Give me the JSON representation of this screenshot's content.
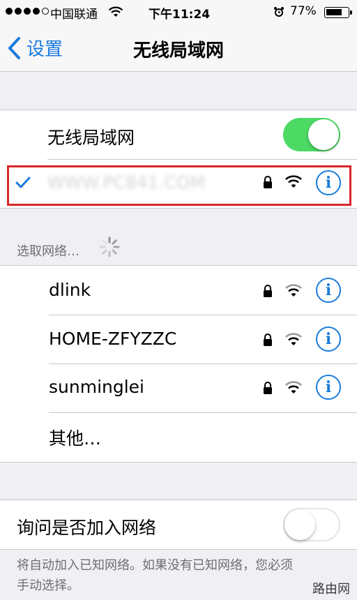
{
  "status_bar": {
    "carrier": "中国联通",
    "time": "下午11:24",
    "battery": "77%",
    "battery_level": 0.77
  },
  "nav": {
    "back_label": "设置",
    "title": "无线局域网"
  },
  "wifi_toggle": {
    "label": "无线局域网",
    "on": true
  },
  "connected_network": {
    "name": "WWW.PC841.COM",
    "secured": true,
    "selected": true
  },
  "choose_network_header": "选取网络…",
  "networks": [
    {
      "name": "dlink",
      "secured": true
    },
    {
      "name": "HOME-ZFYZZC",
      "secured": true
    },
    {
      "name": "sunminglei",
      "secured": true
    }
  ],
  "other_label": "其他…",
  "ask_to_join": {
    "label": "询问是否加入网络",
    "on": false
  },
  "footer_text_line1": "将自动加入已知网络。如果没有已知网络，您必须",
  "footer_text_line2": "手动选择。",
  "watermark": "路由网",
  "colors": {
    "accent": "#1a7bdc",
    "toggle_on": "#4cd964",
    "highlight": "#d9262c"
  }
}
